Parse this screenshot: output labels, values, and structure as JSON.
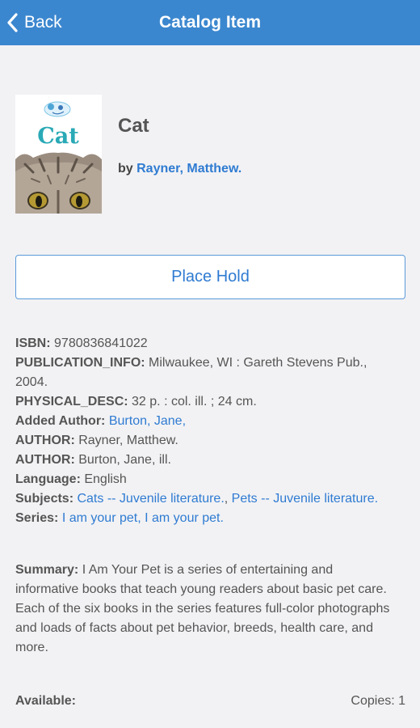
{
  "navbar": {
    "back_label": "Back",
    "title": "Catalog Item",
    "color": "#3b87cf"
  },
  "item": {
    "cover_text": "Cat",
    "title": "Cat",
    "by_prefix": "by",
    "author": "Rayner, Matthew."
  },
  "hold_button": {
    "label": "Place Hold"
  },
  "details": {
    "isbn_label": "ISBN:",
    "isbn_value": "9780836841022",
    "pubinfo_label": "PUBLICATION_INFO:",
    "pubinfo_value": "Milwaukee, WI : Gareth Stevens Pub., 2004.",
    "physdesc_label": "PHYSICAL_DESC:",
    "physdesc_value": "32 p. : col. ill. ; 24 cm.",
    "added_author_label": "Added Author:",
    "added_author_value": "Burton, Jane,",
    "author1_label": "AUTHOR:",
    "author1_value": "Rayner, Matthew.",
    "author2_label": "AUTHOR:",
    "author2_value": "Burton, Jane, ill.",
    "language_label": "Language:",
    "language_value": "English",
    "subjects_label": "Subjects:",
    "subjects": [
      "Cats -- Juvenile literature.",
      "Pets -- Juvenile literature."
    ],
    "series_label": "Series:",
    "series": [
      "I am your pet,",
      "I am your pet."
    ]
  },
  "summary": {
    "label": "Summary:",
    "text": "I Am Your Pet is a series of entertaining and informative books that teach young readers about basic pet care. Each of the six books in the series features full-color photographs and loads of facts about pet behavior, breeds, health care, and more."
  },
  "availability": {
    "label": "Available:",
    "copies": "Copies: 1"
  },
  "colors": {
    "link": "#2f7bd2",
    "background": "#f2f2f4"
  }
}
